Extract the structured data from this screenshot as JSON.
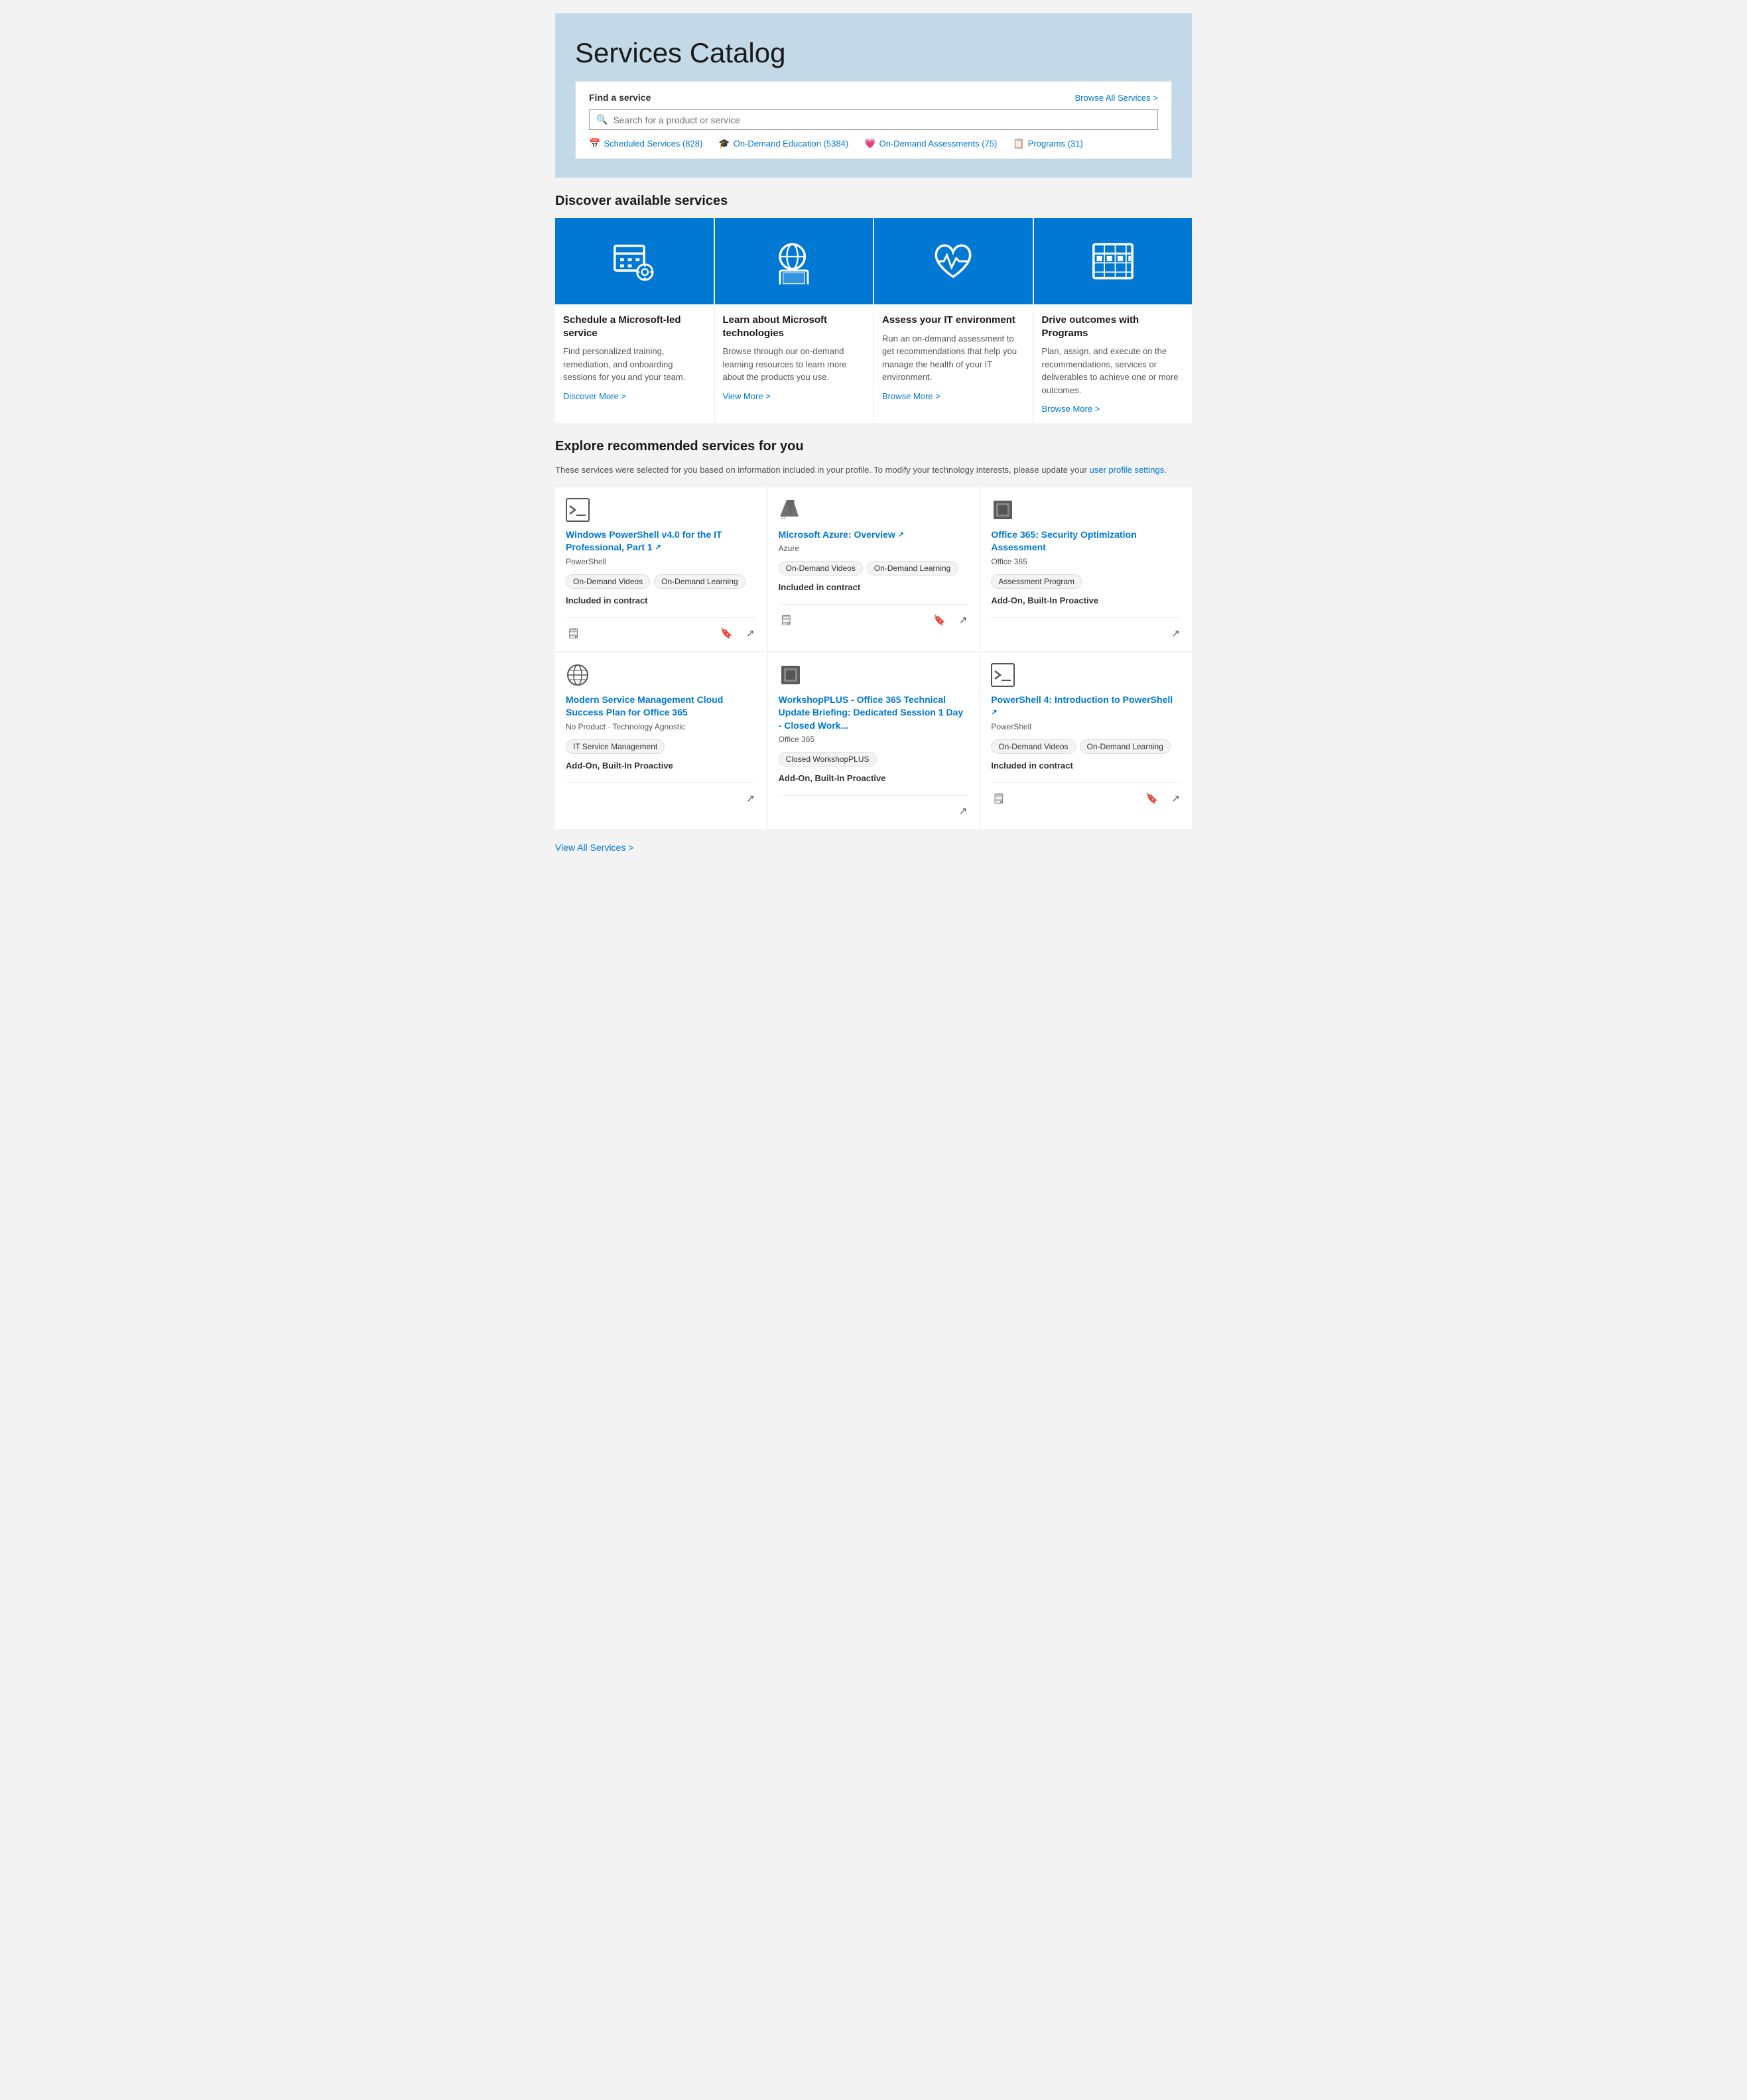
{
  "page": {
    "title": "Services Catalog",
    "search": {
      "label": "Find a service",
      "browse_all": "Browse All Services >",
      "placeholder": "Search for a product or service"
    },
    "filters": [
      {
        "icon": "📅",
        "label": "Scheduled Services (828)"
      },
      {
        "icon": "🎓",
        "label": "On-Demand Education (5384)"
      },
      {
        "icon": "💗",
        "label": "On-Demand Assessments (75)"
      },
      {
        "icon": "📋",
        "label": "Programs (31)"
      }
    ],
    "discover_title": "Discover available services",
    "discover_cards": [
      {
        "title": "Schedule a Microsoft-led service",
        "desc": "Find personalized training, remediation, and onboarding sessions for you and your team.",
        "link": "Discover More >"
      },
      {
        "title": "Learn about Microsoft technologies",
        "desc": "Browse through our on-demand learning resources to learn more about the products you use.",
        "link": "View More >"
      },
      {
        "title": "Assess your IT environment",
        "desc": "Run an on-demand assessment to get recommendations that help you manage the health of your IT environment.",
        "link": "Browse More >"
      },
      {
        "title": "Drive outcomes with Programs",
        "desc": "Plan, assign, and execute on the recommendations, services or deliverables to achieve one or more outcomes.",
        "link": "Browse More >"
      }
    ],
    "recommended_title": "Explore recommended services for you",
    "recommended_subtitle": "These services were selected for you based on information included in your profile. To modify your technology interests, please update your",
    "recommended_link_text": "user profile settings.",
    "recommended_cards": [
      {
        "title": "Windows PowerShell v4.0 for the IT Professional, Part 1",
        "external": true,
        "sub": "PowerShell",
        "tags": [
          "On-Demand Videos",
          "On-Demand Learning"
        ],
        "pricing": "Included in contract",
        "has_cart": true,
        "has_bookmark": true,
        "has_share": true,
        "icon_type": "terminal"
      },
      {
        "title": "Microsoft Azure: Overview",
        "external": true,
        "sub": "Azure",
        "tags": [
          "On-Demand Videos",
          "On-Demand Learning"
        ],
        "pricing": "Included in contract",
        "has_cart": true,
        "has_bookmark": true,
        "has_share": true,
        "icon_type": "azure"
      },
      {
        "title": "Office 365: Security Optimization Assessment",
        "external": false,
        "sub": "Office 365",
        "tags": [
          "Assessment Program"
        ],
        "pricing": "Add-On, Built-In Proactive",
        "has_cart": false,
        "has_bookmark": false,
        "has_share": true,
        "icon_type": "office"
      },
      {
        "title": "Modern Service Management Cloud Success Plan for Office 365",
        "external": false,
        "sub": "No Product · Technology Agnostic",
        "tags": [
          "IT Service Management"
        ],
        "pricing": "Add-On, Built-In Proactive",
        "has_cart": false,
        "has_bookmark": false,
        "has_share": true,
        "icon_type": "globe"
      },
      {
        "title": "WorkshopPLUS - Office 365 Technical Update Briefing: Dedicated Session 1 Day - Closed Work...",
        "external": false,
        "sub": "Office 365",
        "tags": [
          "Closed WorkshopPLUS"
        ],
        "pricing": "Add-On, Built-In Proactive",
        "has_cart": false,
        "has_bookmark": false,
        "has_share": true,
        "icon_type": "office"
      },
      {
        "title": "PowerShell 4: Introduction to PowerShell",
        "external": true,
        "sub": "PowerShell",
        "tags": [
          "On-Demand Videos",
          "On-Demand Learning"
        ],
        "pricing": "Included in contract",
        "has_cart": true,
        "has_bookmark": true,
        "has_share": true,
        "icon_type": "terminal"
      }
    ],
    "view_all": "View All Services >"
  }
}
